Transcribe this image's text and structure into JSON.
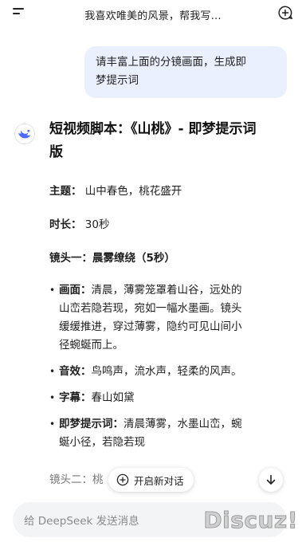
{
  "header": {
    "title": "我喜欢唯美的风景，帮我写..."
  },
  "user_message": {
    "line1": "请丰富上面的分镜画面，生成即",
    "line2": "梦提示词"
  },
  "answer": {
    "title_line1": "短视频脚本：《山桃》- 即梦提示词",
    "title_line2": "版",
    "theme_label": "主题：",
    "theme_value": "山中春色，桃花盛开",
    "duration_label": "时长：",
    "duration_value": "30秒",
    "shot1_heading": "镜头一：晨雾缭绕（5秒）",
    "bullets": [
      {
        "label": "画面：",
        "l1": "清晨，薄雾笼罩着山谷，远处的",
        "l2": "山峦若隐若现，宛如一幅水墨画。镜头",
        "l3": "缓缓推进，穿过薄雾，隐约可见山间小",
        "l4": "径蜿蜒而上。"
      },
      {
        "label": "音效：",
        "l1": "鸟鸣声，流水声，轻柔的风声。"
      },
      {
        "label": "字幕：",
        "l1": "春山如黛"
      },
      {
        "label": "即梦提示词：",
        "l1": "清晨薄雾，水墨山峦，蜿",
        "l2": "蜒小径，若隐若现"
      }
    ],
    "shot2_partial": "镜头二：桃"
  },
  "controls": {
    "new_chat_label": "开启新对话"
  },
  "input": {
    "placeholder": "给 DeepSeek 发送消息"
  },
  "watermark": "Discuz!",
  "colors": {
    "bubble": "#eaf0fd",
    "brand_blue": "#4d6bfe"
  }
}
